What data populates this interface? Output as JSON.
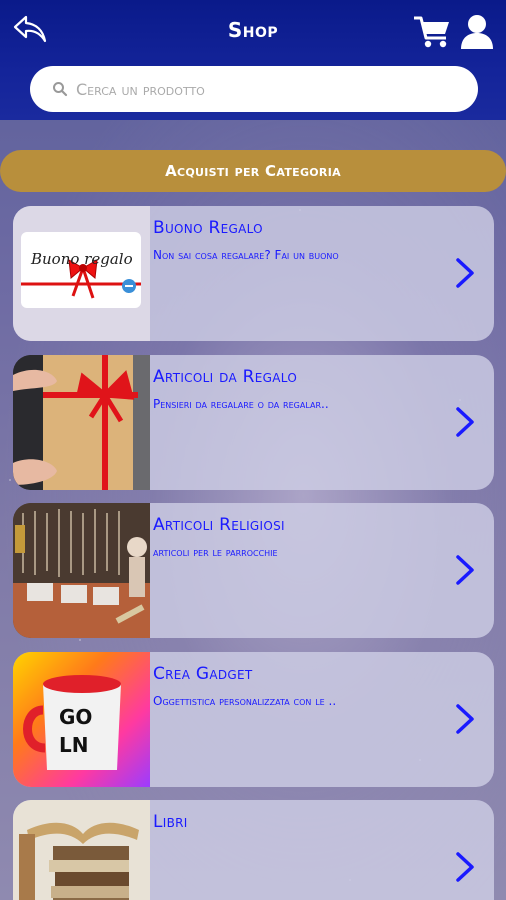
{
  "header": {
    "title": "Shop",
    "back_icon": "back-arrow-icon",
    "cart_icon": "cart-icon",
    "user_icon": "user-icon"
  },
  "search": {
    "placeholder": "Cerca un prodotto",
    "icon": "search-icon"
  },
  "category_bar": {
    "label": "Acquisti per Categoria",
    "color": "#b88f3c"
  },
  "categories": [
    {
      "title": "Buono Regalo",
      "description": "Non sai cosa regalare? Fai un buono",
      "thumbnail_text": "Buono regalo"
    },
    {
      "title": "Articoli da Regalo",
      "description": "Pensieri da regalare o da regalar.."
    },
    {
      "title": "Articoli Religiosi",
      "description": "articoli per le parrocchie"
    },
    {
      "title": "Crea Gadget",
      "description": "Oggettistica personalizzata con le .."
    },
    {
      "title": "Libri",
      "description": ""
    }
  ],
  "colors": {
    "header": "#0a1a8a",
    "accent_text": "#1a1aff",
    "card_bg": "#cdcde4"
  }
}
